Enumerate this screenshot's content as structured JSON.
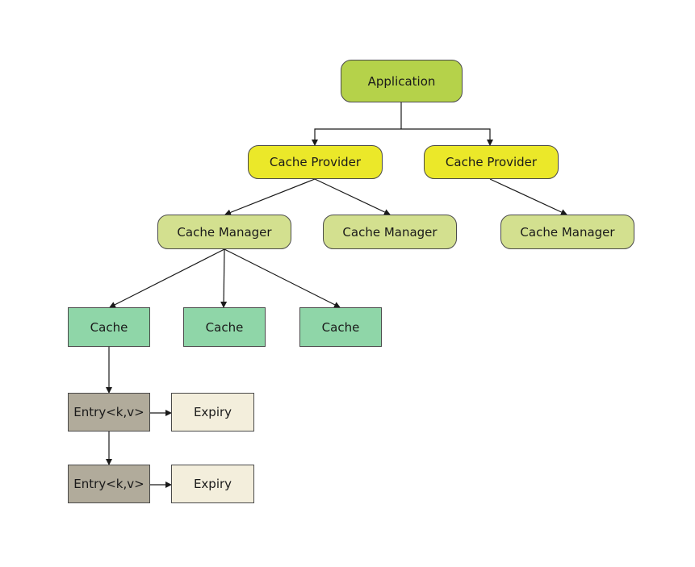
{
  "diagram": {
    "application": {
      "label": "Application"
    },
    "providers": [
      {
        "label": "Cache Provider"
      },
      {
        "label": "Cache Provider"
      }
    ],
    "managers": [
      {
        "label": "Cache Manager"
      },
      {
        "label": "Cache Manager"
      },
      {
        "label": "Cache Manager"
      }
    ],
    "caches": [
      {
        "label": "Cache"
      },
      {
        "label": "Cache"
      },
      {
        "label": "Cache"
      }
    ],
    "entries": [
      {
        "label": "Entry<k,v>"
      },
      {
        "label": "Entry<k,v>"
      }
    ],
    "expiries": [
      {
        "label": "Expiry"
      },
      {
        "label": "Expiry"
      }
    ],
    "colors": {
      "application": "#b5d24a",
      "provider": "#ebe829",
      "manager": "#d3e08f",
      "cache": "#8fd6a8",
      "entry": "#b1ab9b",
      "expiry": "#f3eedc",
      "edge": "#1a1a1a"
    }
  }
}
